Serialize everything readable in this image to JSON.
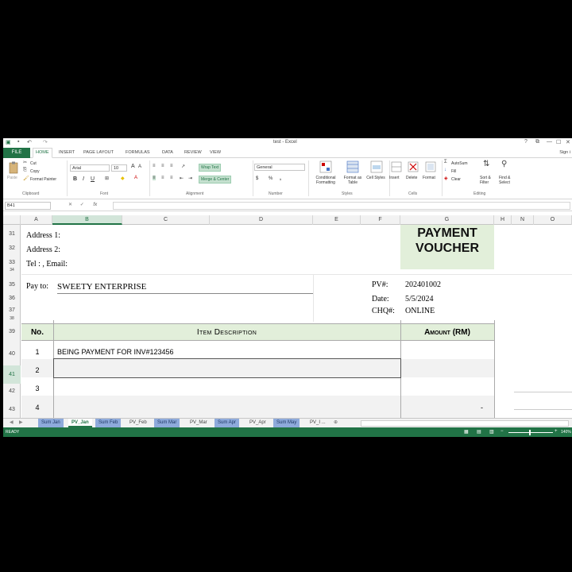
{
  "window": {
    "title": "test - Excel",
    "controls": [
      "?",
      "⧉",
      "—",
      "☐",
      "✕"
    ]
  },
  "ribbon_tabs": [
    "FILE",
    "HOME",
    "INSERT",
    "PAGE LAYOUT",
    "FORMULAS",
    "DATA",
    "REVIEW",
    "VIEW"
  ],
  "signin": "Sign i",
  "ribbon": {
    "clipboard": {
      "paste": "Paste",
      "cut": "Cut",
      "copy": "Copy",
      "format_painter": "Format Painter",
      "label": "Clipboard"
    },
    "font": {
      "name": "Arial",
      "size": "10",
      "label": "Font",
      "bold": "B",
      "italic": "I",
      "underline": "U",
      "grow": "A",
      "shrink": "A"
    },
    "alignment": {
      "wrap": "Wrap Text",
      "merge": "Merge & Center",
      "label": "Alignment"
    },
    "number": {
      "format": "General",
      "label": "Number",
      "currency": "$",
      "percent": "%",
      "comma": ","
    },
    "styles": {
      "conditional": "Conditional Formatting",
      "table": "Format as Table",
      "cell": "Cell Styles",
      "label": "Styles"
    },
    "cells": {
      "insert": "Insert",
      "delete": "Delete",
      "format": "Format",
      "label": "Cells"
    },
    "editing": {
      "autosum": "AutoSum",
      "fill": "Fill",
      "clear": "Clear",
      "sort": "Sort & Filter",
      "find": "Find & Select",
      "label": "Editing"
    }
  },
  "formula_bar": {
    "name_box": "B41",
    "fx": "fx",
    "value": ""
  },
  "columns": [
    "A",
    "B",
    "C",
    "D",
    "E",
    "F",
    "G",
    "H",
    "N",
    "O"
  ],
  "rows": [
    "31",
    "32",
    "33",
    "34",
    "35",
    "36",
    "37",
    "38",
    "39",
    "40",
    "41",
    "42",
    "43"
  ],
  "sheet": {
    "address1": "Address 1:",
    "address2": "Address 2:",
    "tel": "Tel :   , Email:",
    "voucher_title_1": "PAYMENT",
    "voucher_title_2": "VOUCHER",
    "pay_to_label": "Pay to:",
    "pay_to_value": "SWEETY ENTERPRISE",
    "pv_label": "PV#:",
    "pv_value": "202401002",
    "date_label": "Date:",
    "date_value": "5/5/2024",
    "chq_label": "CHQ#:",
    "chq_value": "ONLINE",
    "hdr_no": "No.",
    "hdr_desc": "Item Description",
    "hdr_amount": "Amount (RM)",
    "items": [
      {
        "no": "1",
        "desc": "BEING PAYMENT FOR INV#123456",
        "amount": ""
      },
      {
        "no": "2",
        "desc": "",
        "amount": ""
      },
      {
        "no": "3",
        "desc": "",
        "amount": ""
      },
      {
        "no": "4",
        "desc": "",
        "amount": "-"
      }
    ]
  },
  "sheet_tabs": [
    "Sum Jan",
    "PV_Jan",
    "Sum Feb",
    "PV_Feb",
    "Sum Mar",
    "PV_Mar",
    "Sum Apr",
    "PV_Apr",
    "Sum May",
    "PV_I ..."
  ],
  "active_sheet": "PV_Jan",
  "status": {
    "ready": "READY",
    "zoom": "140%"
  },
  "colors": {
    "excel_green": "#217346",
    "header_fill": "#e2efda",
    "sum_tab": "#8eaadb"
  }
}
